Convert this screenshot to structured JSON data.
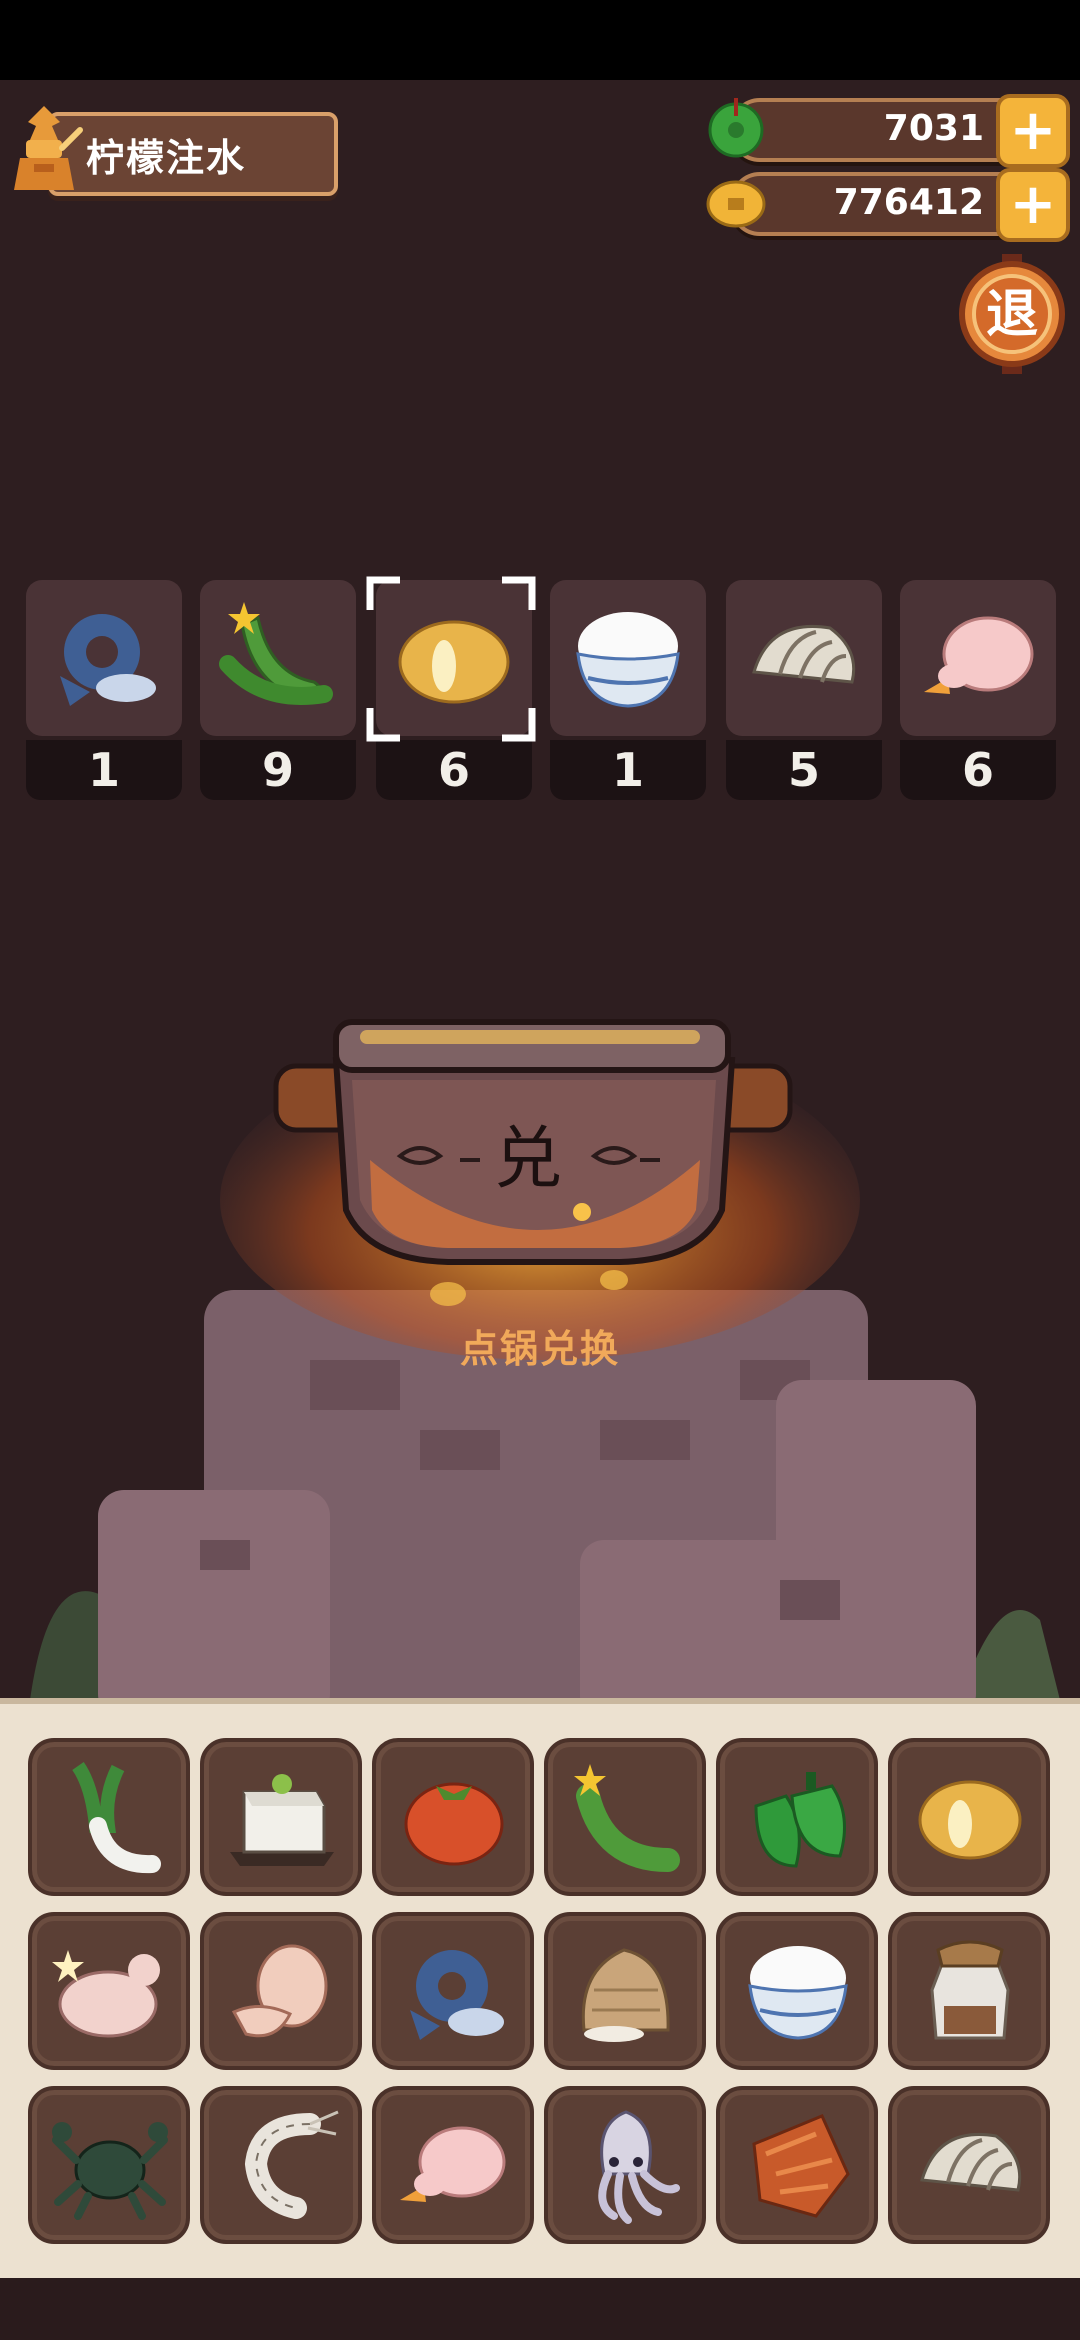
{
  "header": {
    "title": "柠檬注水",
    "jade_amount": "7031",
    "coin_amount": "776412",
    "exit_label": "退"
  },
  "ingredient_row": [
    {
      "name": "fish",
      "count": "1"
    },
    {
      "name": "cucumber",
      "count": "9"
    },
    {
      "name": "potato",
      "count": "6"
    },
    {
      "name": "rice",
      "count": "1"
    },
    {
      "name": "clam",
      "count": "5"
    },
    {
      "name": "duck",
      "count": "6"
    }
  ],
  "pot": {
    "glyph": "兑",
    "hint": "点锅兑换"
  },
  "inventory": [
    [
      "leek",
      "tofu",
      "tomato",
      "cucumber",
      "pepper",
      "potato"
    ],
    [
      "chicken",
      "egg",
      "fish",
      "flour",
      "rice",
      "jar"
    ],
    [
      "crab",
      "shrimp",
      "duck",
      "squid",
      "meat",
      "clam"
    ]
  ],
  "colors": {
    "background": "#2e1e20",
    "accent": "#f4b43a",
    "hint": "#f1a95a"
  }
}
